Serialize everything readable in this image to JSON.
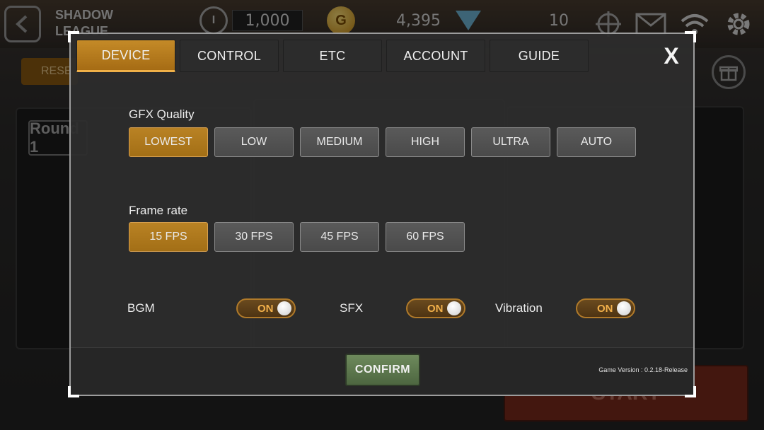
{
  "hud": {
    "league_line1": "SHADOW",
    "league_line2": "LEAGUE",
    "tickets": "1,000",
    "gold": "4,395",
    "gems": "10",
    "reset_label": "RESE",
    "round_label": "Round 1",
    "start_label": "START"
  },
  "settings": {
    "tabs": [
      {
        "label": "DEVICE",
        "active": true
      },
      {
        "label": "CONTROL",
        "active": false
      },
      {
        "label": "ETC",
        "active": false
      },
      {
        "label": "ACCOUNT",
        "active": false
      },
      {
        "label": "GUIDE",
        "active": false
      }
    ],
    "close_label": "X",
    "gfx": {
      "label": "GFX Quality",
      "options": [
        "LOWEST",
        "LOW",
        "MEDIUM",
        "HIGH",
        "ULTRA",
        "AUTO"
      ],
      "selected": "LOWEST"
    },
    "framerate": {
      "label": "Frame rate",
      "options": [
        "15 FPS",
        "30 FPS",
        "45 FPS",
        "60 FPS"
      ],
      "selected": "15 FPS"
    },
    "toggles": [
      {
        "label": "BGM",
        "state": "ON"
      },
      {
        "label": "SFX",
        "state": "ON"
      },
      {
        "label": "Vibration",
        "state": "ON"
      }
    ],
    "confirm_label": "CONFIRM",
    "version": "Game Version : 0.2.18-Release"
  },
  "colors": {
    "accent": "#b98224",
    "confirm": "#5d7a4c"
  }
}
